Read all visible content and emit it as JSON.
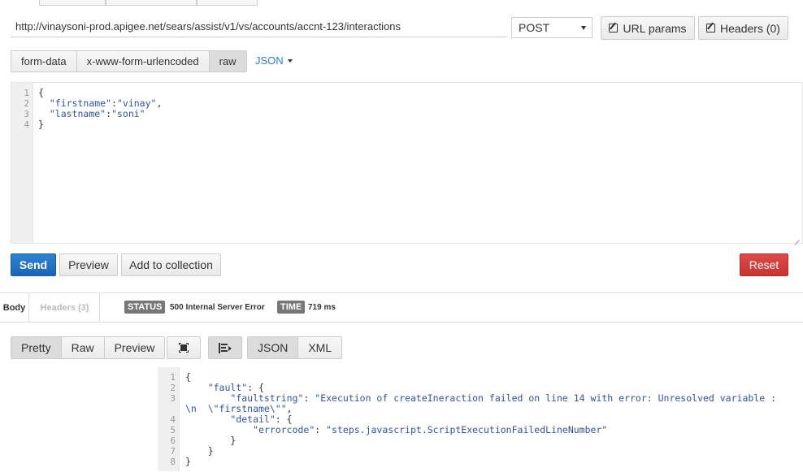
{
  "request": {
    "url": "http://vinaysoni-prod.apigee.net/sears/assist/v1/vs/accounts/accnt-123/interactions",
    "method": "POST",
    "url_params_label": "URL params",
    "headers_label": "Headers (0)",
    "body_types": [
      "form-data",
      "x-www-form-urlencoded",
      "raw"
    ],
    "active_body_type": "raw",
    "format_label": "JSON",
    "body_lines": [
      "1",
      "2",
      "3",
      "4"
    ],
    "body_code": {
      "l1": "{",
      "l2_key": "\"firstname\"",
      "l2_sep": ":",
      "l2_val": "\"vinay\"",
      "l2_end": ",",
      "l3_key": "\"lastname\"",
      "l3_sep": ":",
      "l3_val": "\"soni\"",
      "l4": "}"
    }
  },
  "actions": {
    "send": "Send",
    "preview": "Preview",
    "add_collection": "Add to collection",
    "reset": "Reset"
  },
  "response": {
    "tab_body": "Body",
    "tab_headers": "Headers (3)",
    "status_label": "STATUS",
    "status_value": "500 Internal Server Error",
    "time_label": "TIME",
    "time_value": "719 ms",
    "view_modes": [
      "Pretty",
      "Raw",
      "Preview"
    ],
    "active_view_mode": "Pretty",
    "formats": [
      "JSON",
      "XML"
    ],
    "active_format": "JSON",
    "line_numbers": [
      "1",
      "2",
      "3",
      "4",
      "5",
      "6",
      "7",
      "8"
    ],
    "code": {
      "l1": "{",
      "l2_key": "\"fault\"",
      "l2_rest": ": {",
      "l3_key": "\"faultstring\"",
      "l3_sep": ": ",
      "l3_val": "\"Execution of createIneraction failed on line 14 with error: Unresolved variable :",
      "l3b_val": "\\n  \\\"firstname\\\"\"",
      "l3b_end": ",",
      "l4_key": "\"detail\"",
      "l4_rest": ": {",
      "l5_key": "\"errorcode\"",
      "l5_sep": ": ",
      "l5_val": "\"steps.javascript.ScriptExecutionFailedLineNumber\"",
      "l6": "}",
      "l7": "}",
      "l8": "}"
    }
  }
}
